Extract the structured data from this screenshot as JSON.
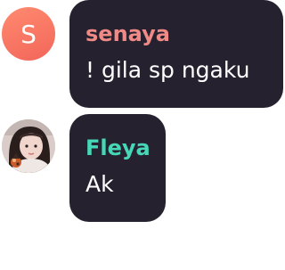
{
  "messages": [
    {
      "avatar_letter": "S",
      "sender": "senaya",
      "sender_color": "#f08a86",
      "text": "! gila sp ngaku"
    },
    {
      "avatar_type": "photo",
      "sender": "Fleya",
      "sender_color": "#46d7b8",
      "text": "Ak"
    }
  ]
}
